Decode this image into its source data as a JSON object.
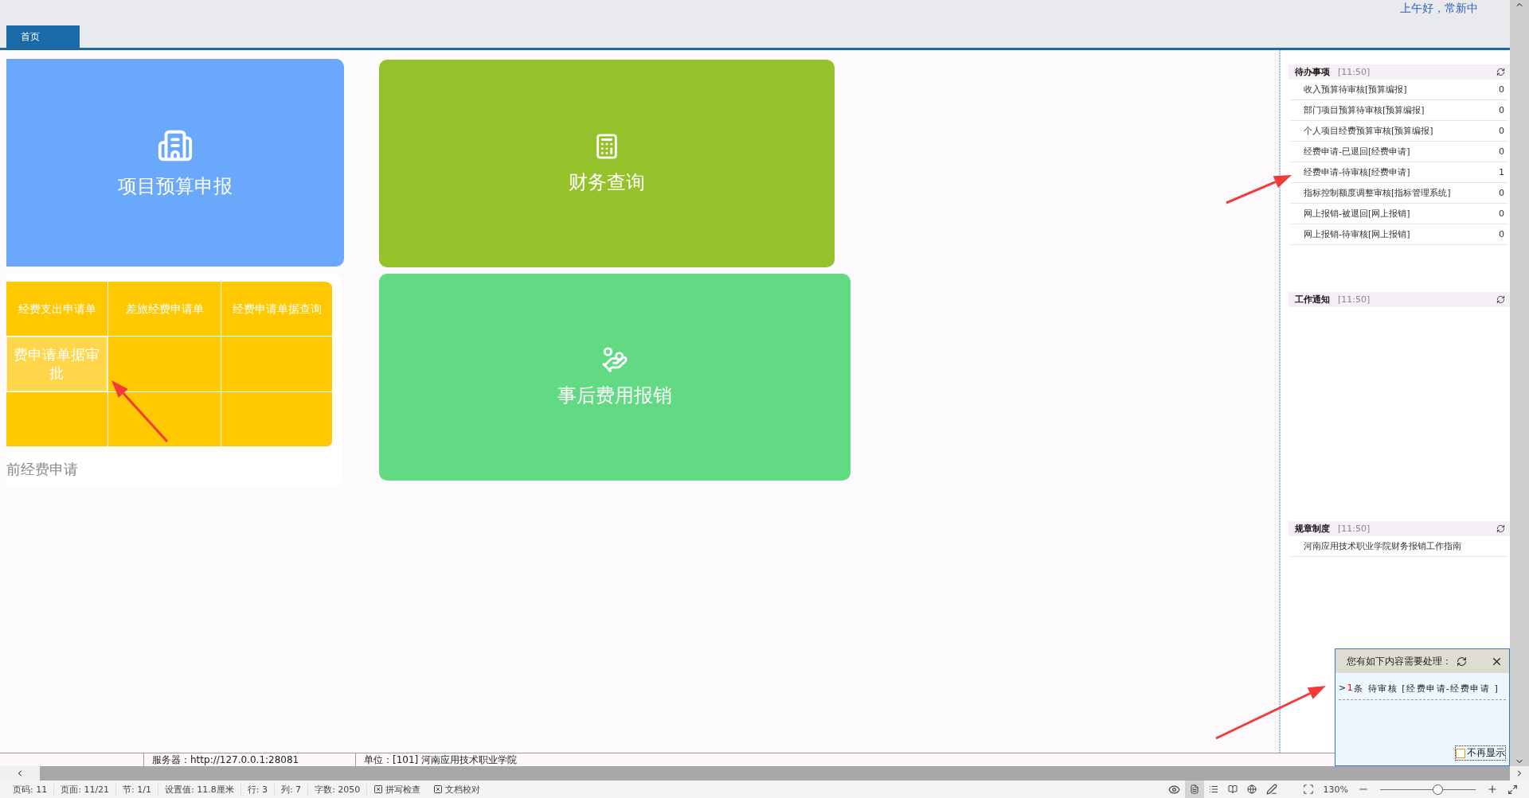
{
  "header": {
    "greeting": "上午好，常新中"
  },
  "tabs": [
    {
      "label": "首页",
      "selected": true
    }
  ],
  "tiles": [
    {
      "title": "项目预算申报",
      "color": "#6aa8fb"
    },
    {
      "title": "财务查询",
      "color": "#95c22a"
    },
    {
      "title": "事后费用报销",
      "color": "#62da84"
    }
  ],
  "apply_group": {
    "label": "前经费申请",
    "color": "#ffc800",
    "cells": [
      {
        "label": "经费支出申请单",
        "highlighted": false
      },
      {
        "label": "差旅经费申请单",
        "highlighted": false
      },
      {
        "label": "经费申请单据查询",
        "highlighted": false
      },
      {
        "label": "费申请单据审批",
        "highlighted": true
      },
      {
        "highlighted": false
      },
      {
        "highlighted": false
      },
      {
        "highlighted": false
      },
      {
        "highlighted": false
      },
      {
        "highlighted": false
      }
    ]
  },
  "right_panel": {
    "sections": [
      {
        "title": "待办事项",
        "time": "[11:50]",
        "items": [
          {
            "label": "收入预算待审核[预算编报]",
            "count": "0"
          },
          {
            "label": "部门项目预算待审核[预算编报]",
            "count": "0"
          },
          {
            "label": "个人项目经费预算审核[预算编报]",
            "count": "0"
          },
          {
            "label": "经费申请-已退回[经费申请]",
            "count": "0"
          },
          {
            "label": "经费申请-待审核[经费申请]",
            "count": "1"
          },
          {
            "label": "指标控制额度调整审核[指标管理系统]",
            "count": "0"
          },
          {
            "label": "网上报销-被退回[网上报销]",
            "count": "0"
          },
          {
            "label": "网上报销-待审核[网上报销]",
            "count": "0"
          }
        ]
      },
      {
        "title": "工作通知",
        "time": "[11:50]"
      },
      {
        "title": "规章制度",
        "time": "[11:50]",
        "items": [
          {
            "label": "河南应用技术职业学院财务报销工作指南"
          }
        ]
      }
    ]
  },
  "server_bar": {
    "server": "服务器：http://127.0.0.1:28081",
    "unit": "单位：[101] 河南应用技术职业学院"
  },
  "popup": {
    "title": "您有如下内容需要处理：",
    "marker": ">",
    "count": "1",
    "message": "条 待审核 [经费申请-经费申请 ]",
    "dont_show": {
      "label": "不再显示",
      "checked": false
    }
  },
  "word_status": {
    "items": [
      "页码: 11",
      "页面: 11/21",
      "节: 1/1",
      "设置值: 11.8厘米",
      "行: 3",
      "列: 7",
      "字数: 2050"
    ],
    "checks": [
      "拼写检查",
      "文档校对"
    ],
    "views": [
      {
        "kind": "page",
        "selected": true
      },
      {
        "kind": "outline",
        "selected": false
      },
      {
        "kind": "read",
        "selected": false
      },
      {
        "kind": "web",
        "selected": false
      }
    ],
    "zoom": "130%",
    "zoom_slider": {
      "level": 0.6
    }
  }
}
